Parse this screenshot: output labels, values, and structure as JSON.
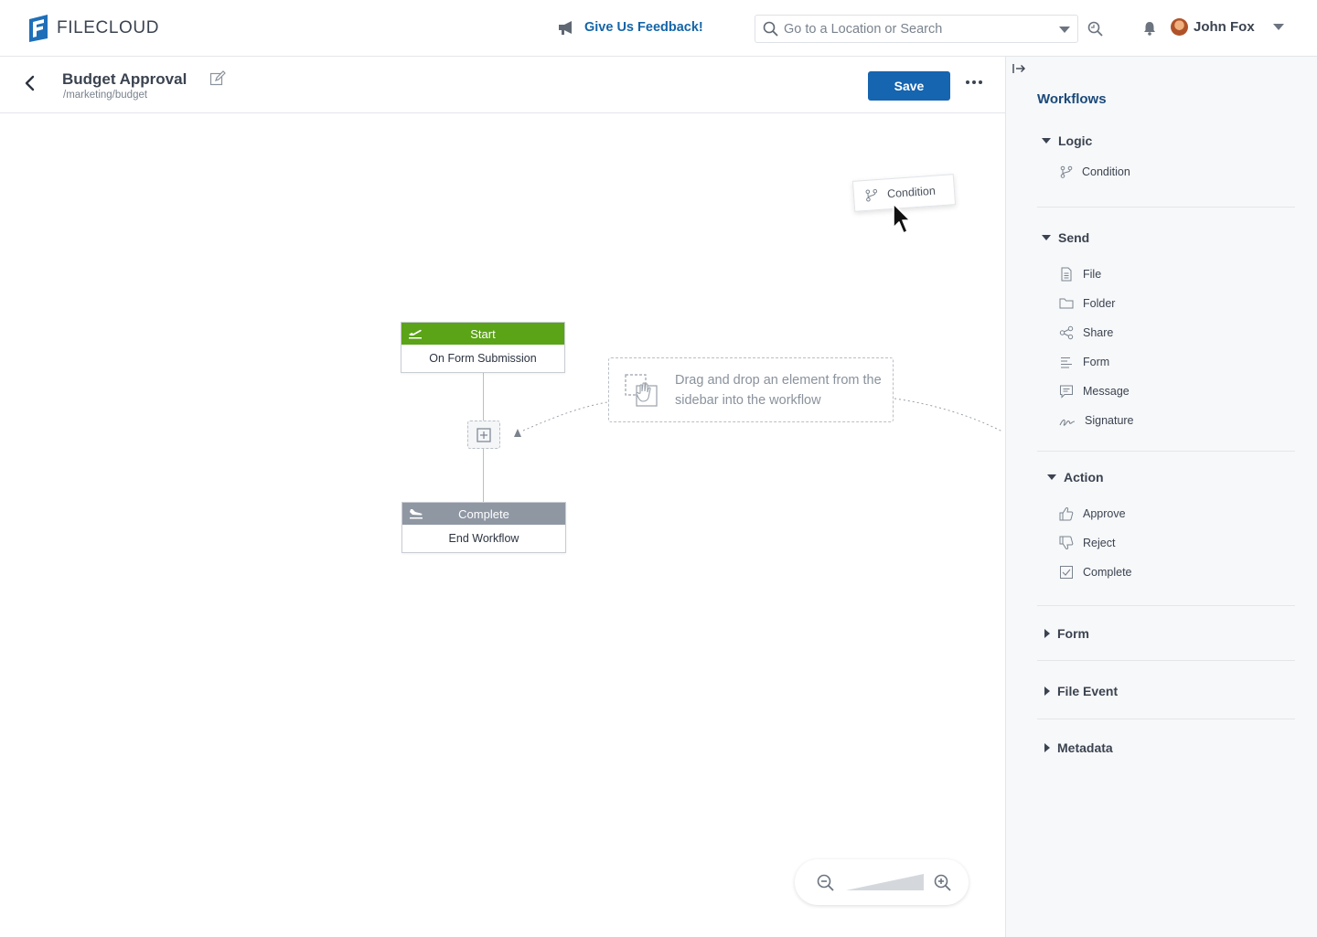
{
  "app": {
    "brand": "FILECLOUD"
  },
  "topbar": {
    "feedback_label": "Give Us Feedback!",
    "search_placeholder": "Go to a Location or Search",
    "user_name": "John Fox"
  },
  "header": {
    "title": "Budget Approval",
    "path": "/marketing/budget",
    "save_label": "Save"
  },
  "canvas": {
    "start_node": {
      "head": "Start",
      "body": "On Form Submission"
    },
    "complete_node": {
      "head": "Complete",
      "body": "End Workflow"
    },
    "drop_hint": "Drag and drop an element from the sidebar into the workflow",
    "drag_ghost_label": "Condition"
  },
  "sidebar": {
    "title": "Workflows",
    "sections": [
      {
        "label": "Logic",
        "expanded": true,
        "items": [
          {
            "label": "Condition",
            "icon": "branch-icon"
          }
        ]
      },
      {
        "label": "Send",
        "expanded": true,
        "items": [
          {
            "label": "File",
            "icon": "file-icon"
          },
          {
            "label": "Folder",
            "icon": "folder-icon"
          },
          {
            "label": "Share",
            "icon": "share-icon"
          },
          {
            "label": "Form",
            "icon": "form-icon"
          },
          {
            "label": "Message",
            "icon": "message-icon"
          },
          {
            "label": "Signature",
            "icon": "signature-icon"
          }
        ]
      },
      {
        "label": "Action",
        "expanded": true,
        "items": [
          {
            "label": "Approve",
            "icon": "thumbs-up-icon"
          },
          {
            "label": "Reject",
            "icon": "thumbs-down-icon"
          },
          {
            "label": "Complete",
            "icon": "checkbox-icon"
          }
        ]
      },
      {
        "label": "Form",
        "expanded": false,
        "items": []
      },
      {
        "label": "File Event",
        "expanded": false,
        "items": []
      },
      {
        "label": "Metadata",
        "expanded": false,
        "items": []
      }
    ]
  },
  "colors": {
    "accent": "#1565b0",
    "start": "#5ba317",
    "complete": "#8f97a3",
    "sidebar_title": "#1b4a7a"
  }
}
